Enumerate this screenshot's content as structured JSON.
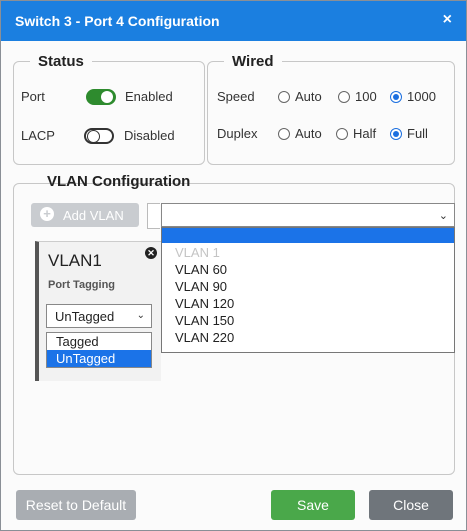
{
  "dialog": {
    "title": "Switch 3 - Port 4 Configuration",
    "close_glyph": "×"
  },
  "status": {
    "legend": "Status",
    "port_label": "Port",
    "port_state": "Enabled",
    "port_on": true,
    "lacp_label": "LACP",
    "lacp_state": "Disabled",
    "lacp_on": false
  },
  "wired": {
    "legend": "Wired",
    "speed_label": "Speed",
    "speed_options": [
      "Auto",
      "100",
      "1000"
    ],
    "speed_selected": "1000",
    "duplex_label": "Duplex",
    "duplex_options": [
      "Auto",
      "Half",
      "Full"
    ],
    "duplex_selected": "Full"
  },
  "vlan": {
    "heading": "VLAN Configuration",
    "add_button": "Add VLAN",
    "add_icon": "plus-circle-icon",
    "select_value": "",
    "select_options": [
      "",
      "VLAN 1",
      "VLAN 60",
      "VLAN 90",
      "VLAN 120",
      "VLAN 150",
      "VLAN 220"
    ],
    "highlighted_index": 0,
    "disabled_option": "VLAN 1",
    "card": {
      "name": "VLAN1",
      "port_tagging_label": "Port Tagging",
      "tagging_value": "UnTagged",
      "tagging_options": [
        "Tagged",
        "UnTagged"
      ],
      "tagging_highlighted": "UnTagged",
      "remove_icon": "close-circle-icon"
    }
  },
  "footer": {
    "reset": "Reset to Default",
    "save": "Save",
    "close": "Close"
  },
  "colors": {
    "titlebar": "#1b7fe0",
    "toggle_on": "#2e8b2e",
    "highlight": "#1b73e8",
    "save": "#4aa84a",
    "close": "#6f757b",
    "reset": "#a9adb2"
  }
}
